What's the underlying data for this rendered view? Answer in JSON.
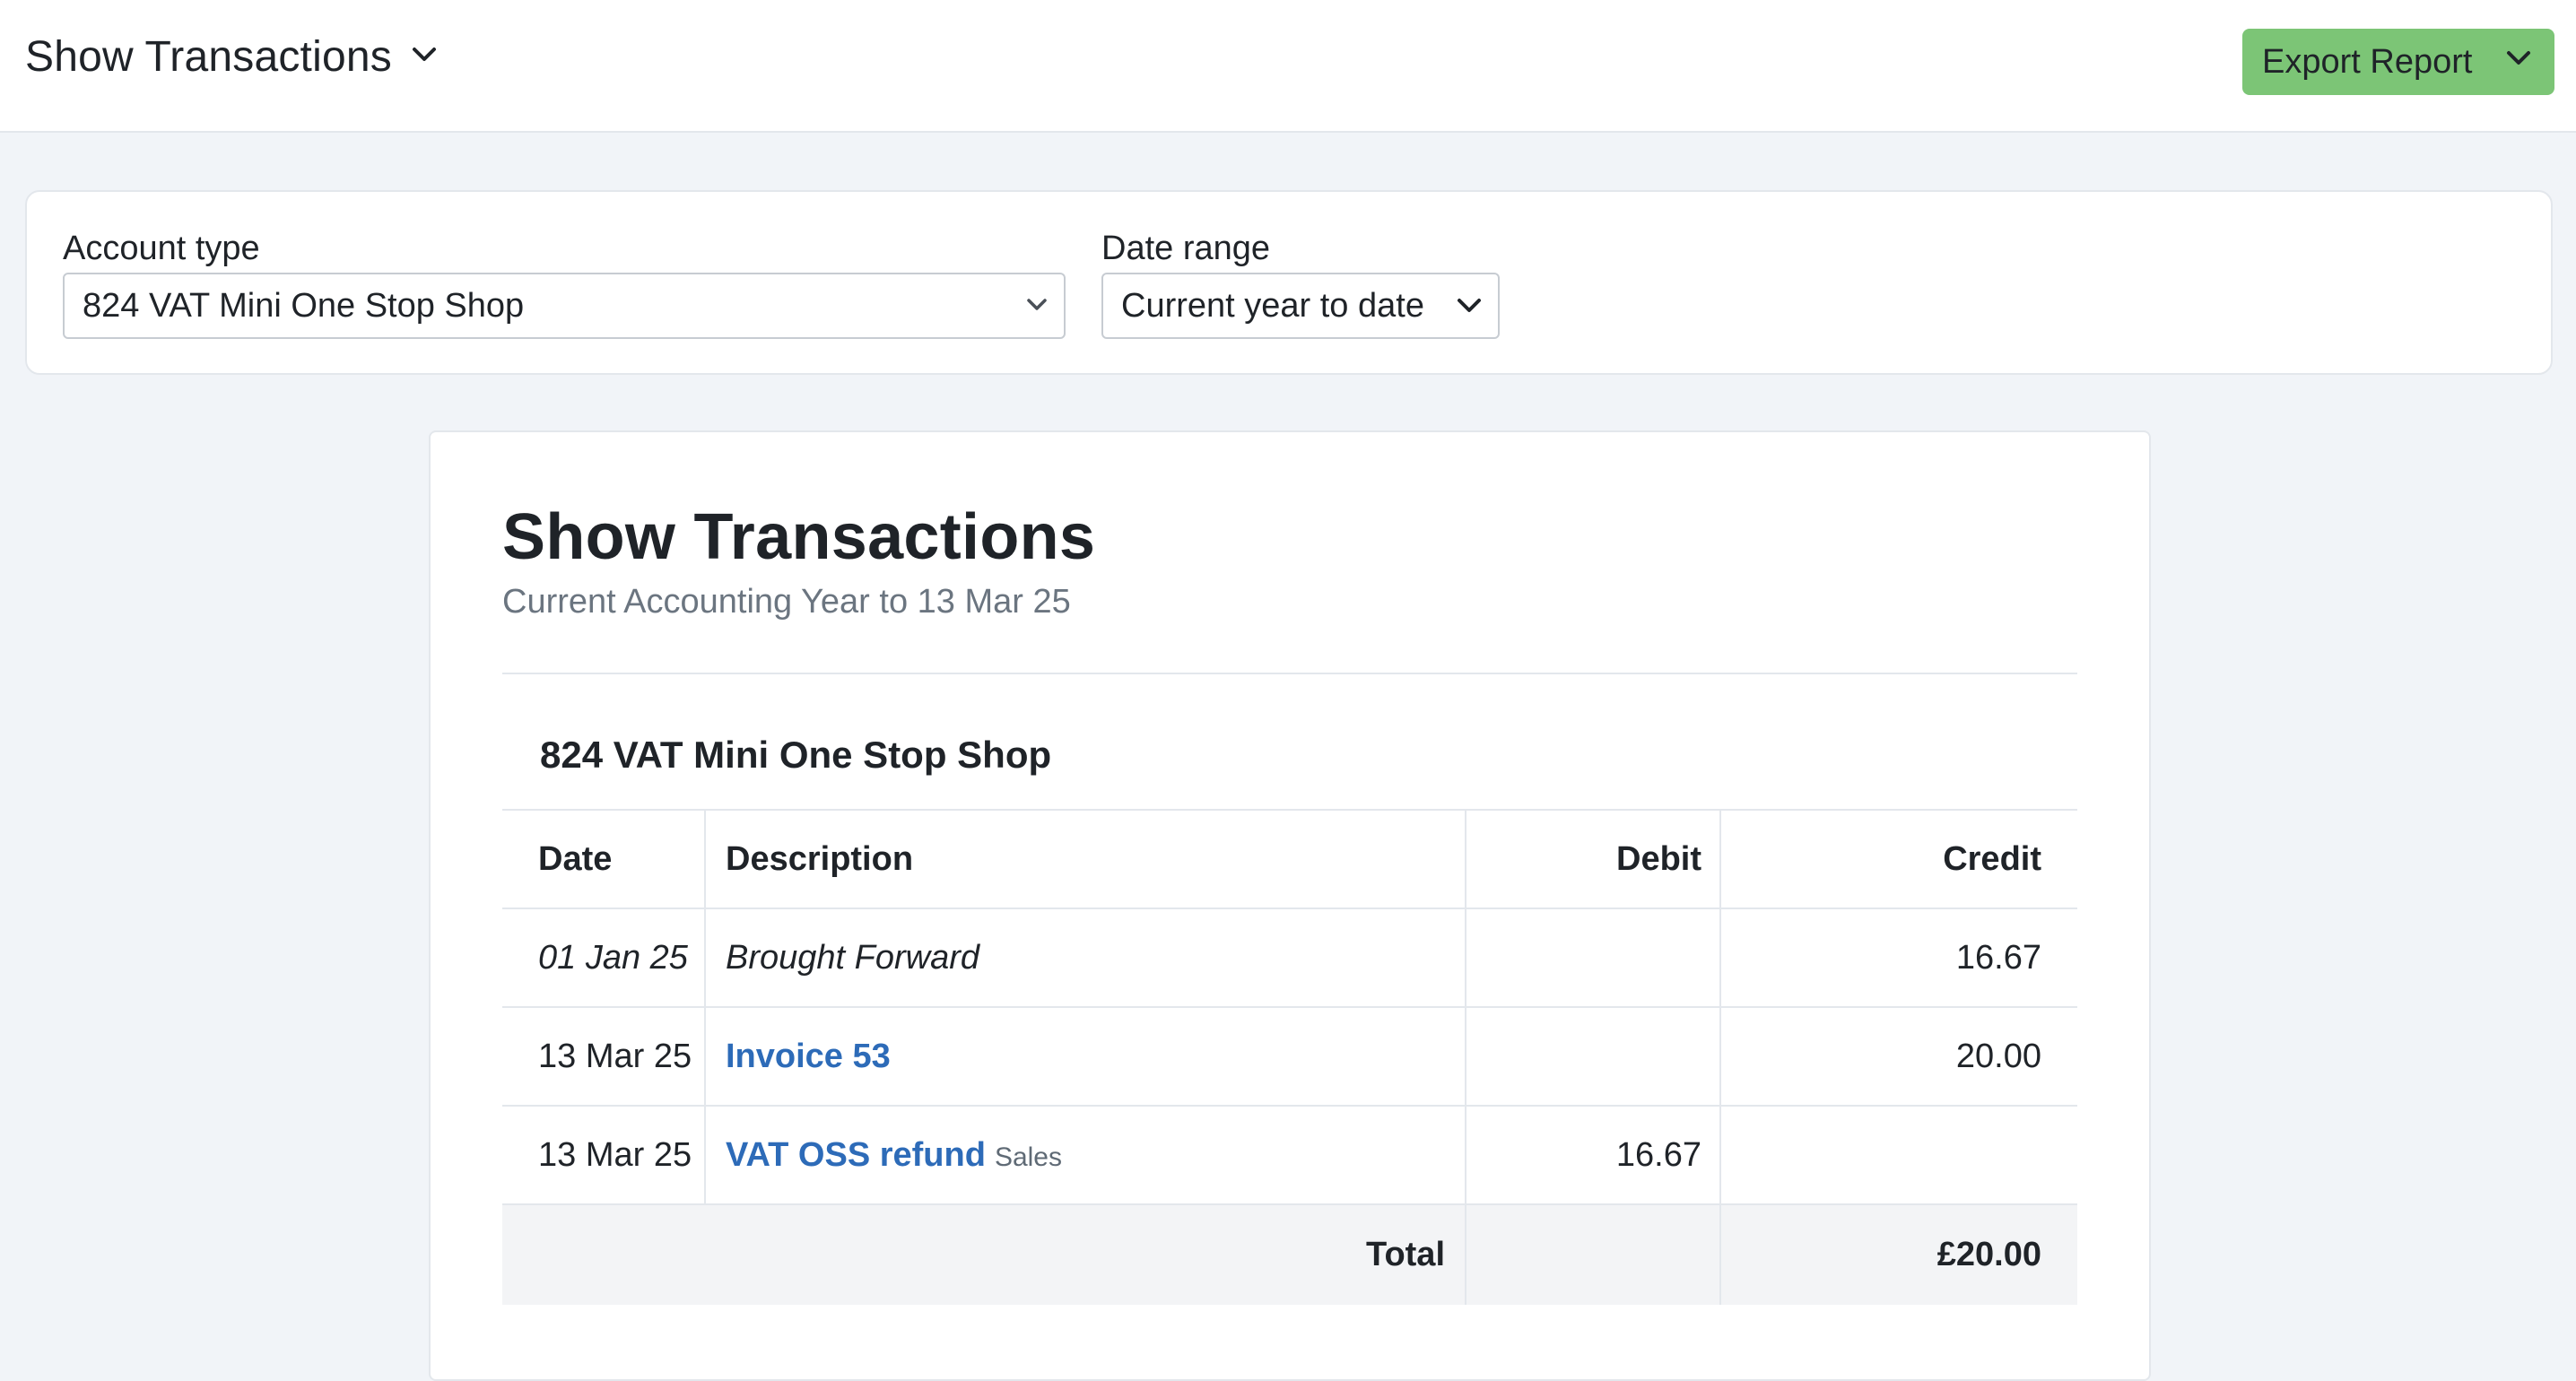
{
  "header": {
    "title": "Show Transactions",
    "title_icon": "chevron-down-icon",
    "export_button_label": "Export Report",
    "export_button_icon": "chevron-down-icon",
    "export_button_color": "#7cc576"
  },
  "filters": {
    "account_type": {
      "label": "Account type",
      "value": "824 VAT Mini One Stop Shop"
    },
    "date_range": {
      "label": "Date range",
      "value": "Current year to date"
    }
  },
  "report": {
    "title": "Show Transactions",
    "subtitle": "Current Accounting Year to 13 Mar 25",
    "account_name": "824 VAT Mini One Stop Shop",
    "columns": {
      "date": "Date",
      "description": "Description",
      "debit": "Debit",
      "credit": "Credit"
    },
    "rows": [
      {
        "date": "01 Jan 25",
        "description": "Brought Forward",
        "tag": "",
        "debit": "",
        "credit": "16.67",
        "is_link": false
      },
      {
        "date": "13 Mar 25",
        "description": "Invoice 53",
        "tag": "",
        "debit": "",
        "credit": "20.00",
        "is_link": true
      },
      {
        "date": "13 Mar 25",
        "description": "VAT OSS refund",
        "tag": "Sales",
        "debit": "16.67",
        "credit": "",
        "is_link": true
      }
    ],
    "total": {
      "label": "Total",
      "debit": "",
      "credit": "£20.00"
    },
    "link_color": "#2d6bb8"
  }
}
